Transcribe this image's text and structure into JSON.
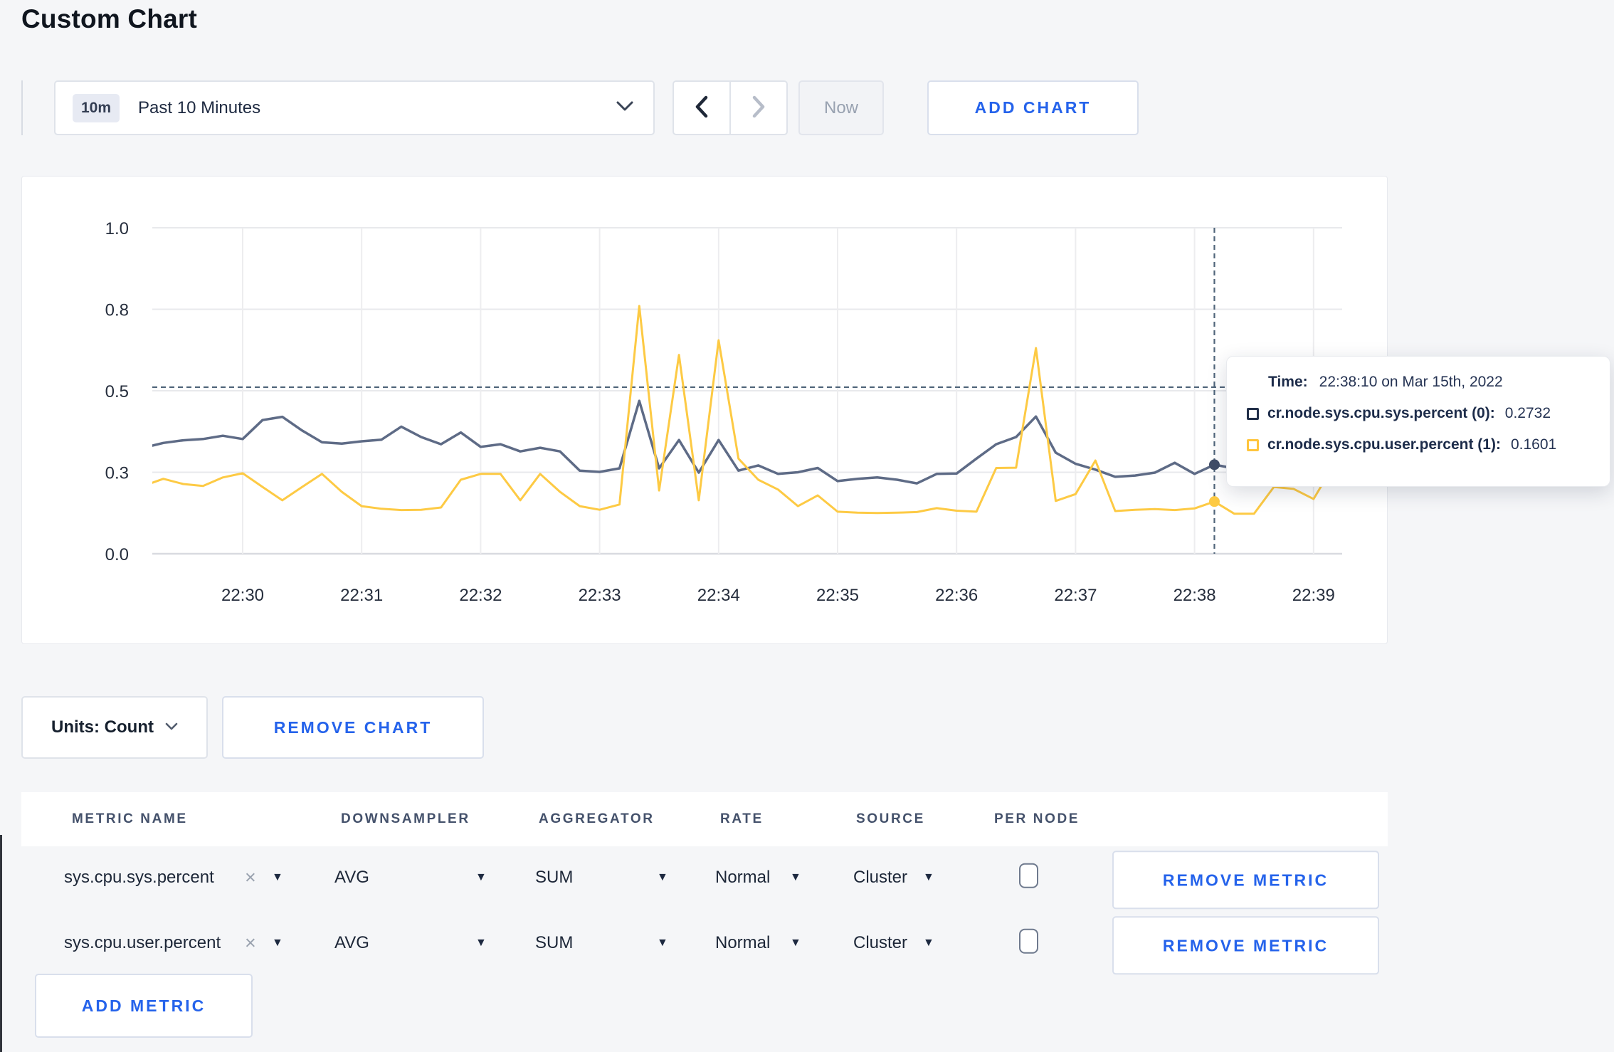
{
  "page": {
    "title": "Custom Chart"
  },
  "toolbar": {
    "time_range_badge": "10m",
    "time_range_label": "Past 10 Minutes",
    "now_label": "Now",
    "add_chart_label": "ADD CHART"
  },
  "icons": {
    "dropdown_chevron": "chevron-down",
    "prev_arrow": "chevron-left",
    "next_arrow": "chevron-right",
    "remove_metric_x": "×",
    "select_caret": "▼"
  },
  "chart": {
    "tooltip": {
      "time_label": "Time:",
      "time_value": "22:38:10 on Mar 15th, 2022",
      "series": [
        {
          "label": "cr.node.sys.cpu.sys.percent (0):",
          "value": "0.2732",
          "color": "#222f49"
        },
        {
          "label": "cr.node.sys.cpu.user.percent (1):",
          "value": "0.1601",
          "color": "#ffc53d"
        }
      ]
    }
  },
  "chart_data": {
    "type": "line",
    "title": "",
    "xlabel": "",
    "ylabel": "",
    "ylim": [
      0,
      1
    ],
    "grid": true,
    "x_start": "22:29:10",
    "x_interval_seconds": 10,
    "x_tick_labels": [
      "22:30",
      "22:31",
      "22:32",
      "22:33",
      "22:34",
      "22:35",
      "22:36",
      "22:37",
      "22:38",
      "22:39"
    ],
    "y_ticks": [
      {
        "value": 1.0,
        "label": "1.0"
      },
      {
        "value": 0.75,
        "label": "0.8"
      },
      {
        "value": 0.5,
        "label": "0.5"
      },
      {
        "value": 0.25,
        "label": "0.3"
      },
      {
        "value": 0.0,
        "label": "0.0"
      }
    ],
    "crosshair": {
      "time": "22:38:10",
      "y_value": 0.511
    },
    "series": [
      {
        "name": "cr.node.sys.cpu.sys.percent",
        "color": "#5e6b86",
        "values": [
          0.325,
          0.34,
          0.348,
          0.352,
          0.362,
          0.352,
          0.41,
          0.42,
          0.378,
          0.342,
          0.338,
          0.345,
          0.35,
          0.39,
          0.358,
          0.336,
          0.372,
          0.328,
          0.336,
          0.314,
          0.325,
          0.314,
          0.255,
          0.251,
          0.262,
          0.469,
          0.262,
          0.349,
          0.249,
          0.349,
          0.255,
          0.271,
          0.245,
          0.25,
          0.263,
          0.223,
          0.23,
          0.234,
          0.227,
          0.216,
          0.245,
          0.246,
          0.292,
          0.336,
          0.358,
          0.421,
          0.31,
          0.276,
          0.258,
          0.236,
          0.24,
          0.249,
          0.279,
          0.245,
          0.2732,
          0.262,
          0.255,
          0.26,
          0.258,
          0.252,
          0.25
        ]
      },
      {
        "name": "cr.node.sys.cpu.user.percent",
        "color": "#fdca44",
        "values": [
          0.208,
          0.23,
          0.214,
          0.208,
          0.234,
          0.247,
          0.205,
          0.164,
          0.205,
          0.245,
          0.19,
          0.146,
          0.138,
          0.134,
          0.135,
          0.142,
          0.227,
          0.245,
          0.245,
          0.164,
          0.245,
          0.19,
          0.146,
          0.135,
          0.151,
          0.76,
          0.194,
          0.61,
          0.164,
          0.655,
          0.292,
          0.227,
          0.197,
          0.146,
          0.179,
          0.129,
          0.126,
          0.125,
          0.126,
          0.128,
          0.14,
          0.132,
          0.129,
          0.263,
          0.264,
          0.631,
          0.162,
          0.183,
          0.286,
          0.131,
          0.135,
          0.137,
          0.134,
          0.139,
          0.1601,
          0.123,
          0.123,
          0.205,
          0.199,
          0.168,
          0.27
        ]
      }
    ],
    "legend": "tooltip-only"
  },
  "chart_controls": {
    "units_label": "Units: Count",
    "remove_chart_label": "REMOVE CHART"
  },
  "metrics_table": {
    "headers": [
      "METRIC NAME",
      "DOWNSAMPLER",
      "AGGREGATOR",
      "RATE",
      "SOURCE",
      "PER NODE"
    ],
    "rows": [
      {
        "name": "sys.cpu.sys.percent",
        "downsampler": "AVG",
        "aggregator": "SUM",
        "rate": "Normal",
        "source": "Cluster",
        "per_node_checked": false,
        "remove_label": "REMOVE METRIC"
      },
      {
        "name": "sys.cpu.user.percent",
        "downsampler": "AVG",
        "aggregator": "SUM",
        "rate": "Normal",
        "source": "Cluster",
        "per_node_checked": false,
        "remove_label": "REMOVE METRIC"
      }
    ],
    "add_metric_label": "ADD METRIC"
  },
  "colors": {
    "accent": "#2563eb",
    "series_sys": "#5e6b86",
    "series_user": "#fdca44"
  }
}
